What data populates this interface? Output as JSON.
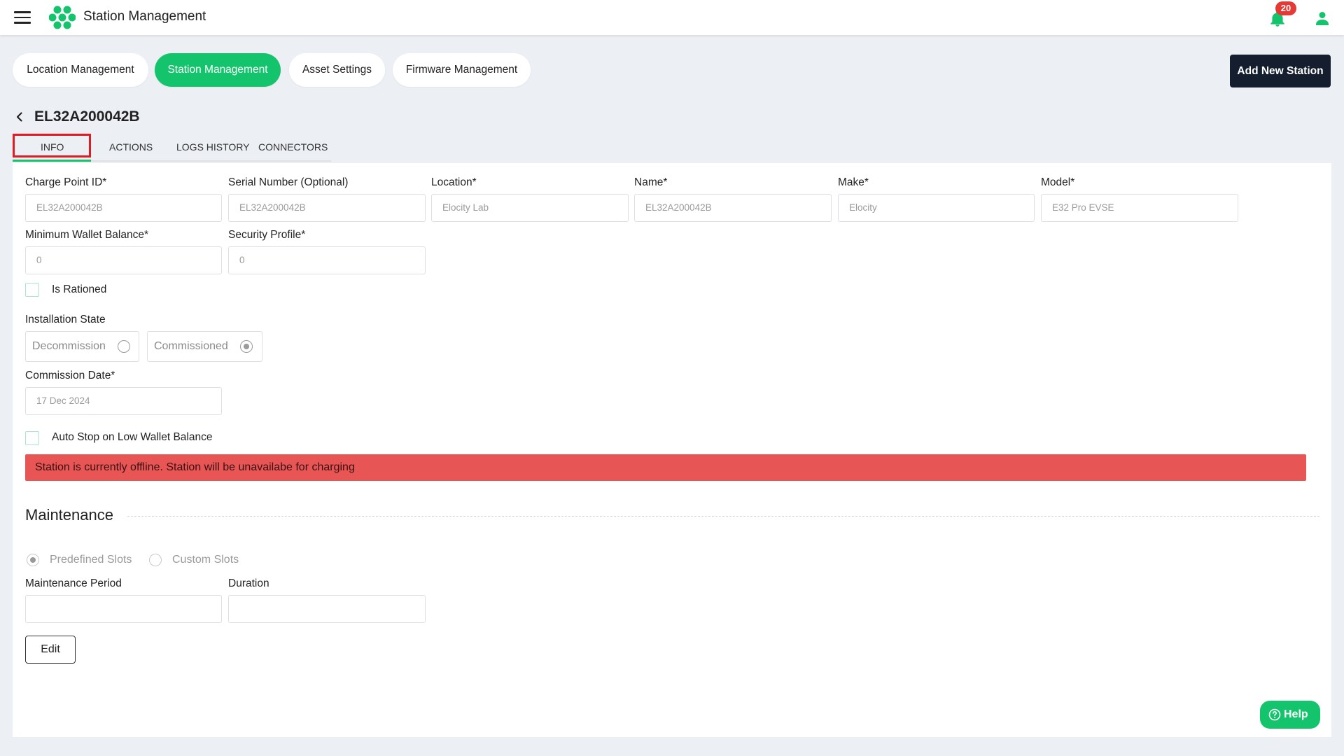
{
  "header": {
    "app_title": "Station Management",
    "notification_count": "20"
  },
  "nav": {
    "pills": [
      {
        "label": "Location Management",
        "active": false
      },
      {
        "label": "Station Management",
        "active": true
      },
      {
        "label": "Asset Settings",
        "active": false
      },
      {
        "label": "Firmware Management",
        "active": false
      }
    ],
    "add_button": "Add New Station"
  },
  "station": {
    "title": "EL32A200042B"
  },
  "tabs": [
    {
      "label": "INFO",
      "active": true
    },
    {
      "label": "ACTIONS",
      "active": false
    },
    {
      "label": "LOGS HISTORY",
      "active": false
    },
    {
      "label": "CONNECTORS",
      "active": false
    }
  ],
  "form": {
    "row1": [
      {
        "label": "Charge Point ID*",
        "value": "EL32A200042B"
      },
      {
        "label": "Serial Number (Optional)",
        "value": "EL32A200042B"
      },
      {
        "label": "Location*",
        "value": "Elocity Lab"
      },
      {
        "label": "Name*",
        "value": "EL32A200042B"
      },
      {
        "label": "Make*",
        "value": "Elocity"
      },
      {
        "label": "Model*",
        "value": "E32 Pro EVSE"
      }
    ],
    "row2": [
      {
        "label": "Minimum Wallet Balance*",
        "value": "0"
      },
      {
        "label": "Security Profile*",
        "value": "0"
      }
    ],
    "is_rationed": {
      "label": "Is Rationed",
      "checked": false
    },
    "installation_state": {
      "label": "Installation State",
      "options": [
        {
          "label": "Decommission",
          "checked": false
        },
        {
          "label": "Commissioned",
          "checked": true
        }
      ]
    },
    "commission_date": {
      "label": "Commission Date*",
      "value": "17 Dec 2024"
    },
    "auto_stop": {
      "label": "Auto Stop on Low Wallet Balance",
      "checked": false
    },
    "alert": "Station is currently offline. Station will be unavailabe for charging"
  },
  "maintenance": {
    "title": "Maintenance",
    "slot_options": [
      {
        "label": "Predefined Slots",
        "checked": true
      },
      {
        "label": "Custom Slots",
        "checked": false
      }
    ],
    "period": {
      "label": "Maintenance Period",
      "value": ""
    },
    "duration": {
      "label": "Duration",
      "value": ""
    }
  },
  "actions": {
    "edit": "Edit",
    "help": "Help"
  },
  "colors": {
    "accent": "#14c46c",
    "dark_button": "#141e2e",
    "alert": "#e85555",
    "badge": "#e53935"
  }
}
